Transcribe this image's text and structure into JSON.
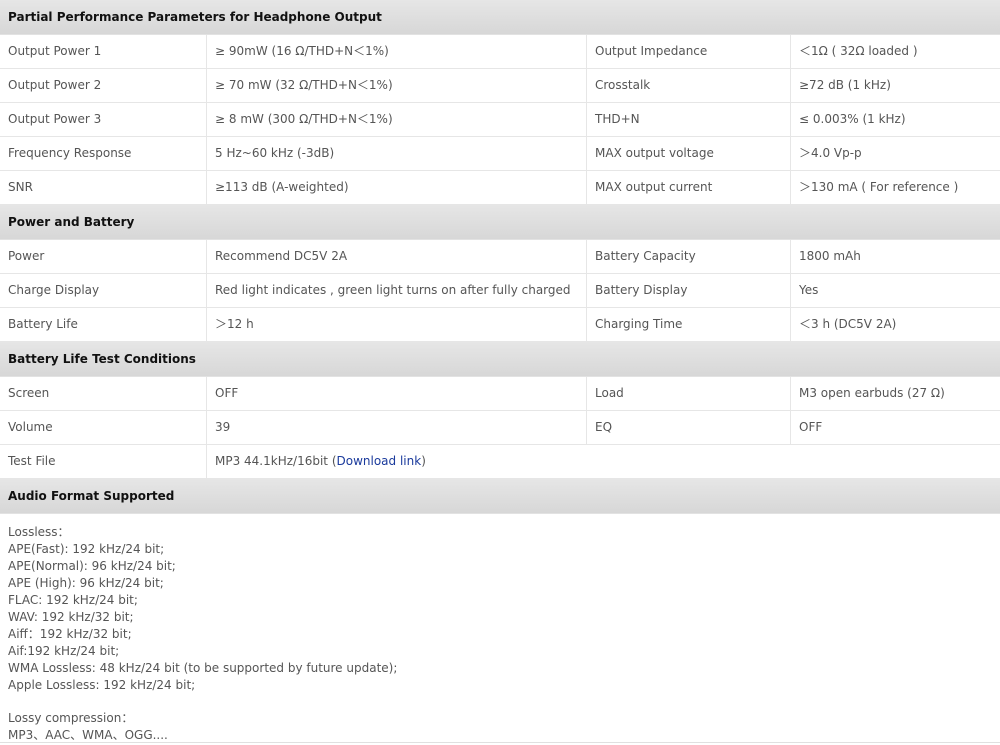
{
  "sections": {
    "headphone": {
      "title": "Partial Performance Parameters for Headphone Output",
      "rows": [
        [
          "Output Power 1",
          "≥ 90mW (16 Ω/THD+N＜1%)",
          "Output Impedance",
          "＜1Ω ( 32Ω loaded )"
        ],
        [
          "Output Power 2",
          "≥ 70 mW (32 Ω/THD+N＜1%)",
          "Crosstalk",
          "≥72 dB (1 kHz)"
        ],
        [
          "Output Power 3",
          "≥ 8 mW (300 Ω/THD+N＜1%)",
          "THD+N",
          "≤ 0.003% (1 kHz)"
        ],
        [
          "Frequency Response",
          "5 Hz~60 kHz (-3dB)",
          "MAX output voltage",
          "＞4.0 Vp-p"
        ],
        [
          "SNR",
          "≥113 dB (A-weighted)",
          "MAX output current",
          "＞130 mA ( For reference )"
        ]
      ]
    },
    "power": {
      "title": "Power and Battery",
      "rows": [
        [
          "Power",
          "Recommend DC5V 2A",
          "Battery Capacity",
          "1800 mAh"
        ],
        [
          "Charge Display",
          "Red light indicates , green light turns on after fully charged",
          "Battery Display",
          "Yes"
        ],
        [
          "Battery Life",
          "＞12 h",
          "Charging Time",
          "＜3 h (DC5V 2A)"
        ]
      ]
    },
    "test": {
      "title": "Battery Life Test Conditions",
      "rows": [
        [
          "Screen",
          "OFF",
          "Load",
          "M3 open earbuds (27 Ω)"
        ],
        [
          "Volume",
          "39",
          "EQ",
          "OFF"
        ]
      ],
      "test_file": {
        "label": "Test File",
        "value_prefix": "MP3 44.1kHz/16bit (",
        "link_text": "Download link",
        "value_suffix": ")"
      }
    },
    "formats": {
      "title": "Audio Format Supported",
      "lossless_lines": [
        "Lossless：",
        "APE(Fast): 192 kHz/24 bit;",
        "APE(Normal): 96 kHz/24 bit;",
        "APE (High): 96 kHz/24 bit;",
        "FLAC: 192 kHz/24 bit;",
        "WAV: 192 kHz/32 bit;",
        "Aiff：192 kHz/32 bit;",
        "Aif:192 kHz/24 bit;",
        "WMA Lossless: 48 kHz/24 bit (to be supported by future update);",
        "Apple Lossless: 192 kHz/24 bit;"
      ],
      "lossy_lines": [
        "Lossy compression：",
        "MP3、AAC、WMA、OGG...."
      ]
    }
  }
}
